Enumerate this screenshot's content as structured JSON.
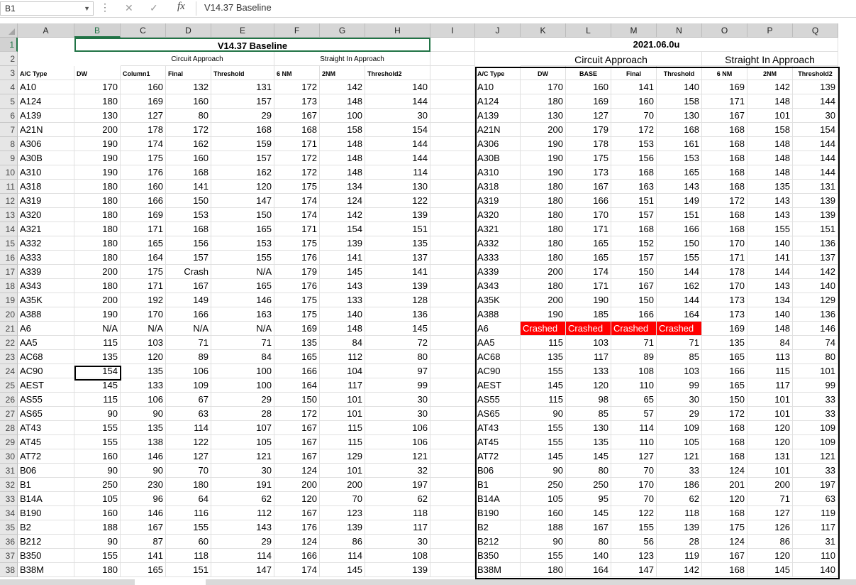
{
  "namebox": "B1",
  "formula_value": "V14.37 Baseline",
  "fx_label": "fx",
  "icons": {
    "cancel": "✕",
    "enter": "✓"
  },
  "column_headers": [
    "A",
    "B",
    "C",
    "D",
    "E",
    "F",
    "G",
    "H",
    "I",
    "J",
    "K",
    "L",
    "M",
    "N",
    "O",
    "P",
    "Q"
  ],
  "row_numbers": [
    "1",
    "2",
    "3",
    "4",
    "5",
    "6",
    "7",
    "8",
    "9",
    "10",
    "11",
    "12",
    "13",
    "14",
    "15",
    "16",
    "17",
    "18",
    "19",
    "20",
    "21",
    "22",
    "23",
    "24",
    "25",
    "26",
    "27",
    "28",
    "29",
    "30",
    "31",
    "32",
    "33",
    "34",
    "35",
    "36",
    "37",
    "38"
  ],
  "left": {
    "title": "V14.37 Baseline",
    "circuit_label": "Circuit Approach",
    "straight_label": "Straight In Approach",
    "headers": [
      "A/C Type",
      "DW",
      "Column1",
      "Final",
      "Threshold",
      "6 NM",
      "2NM",
      "Threshold2"
    ],
    "rows": [
      [
        "A10",
        "170",
        "160",
        "132",
        "131",
        "172",
        "142",
        "140"
      ],
      [
        "A124",
        "180",
        "169",
        "160",
        "157",
        "173",
        "148",
        "144"
      ],
      [
        "A139",
        "130",
        "127",
        "80",
        "29",
        "167",
        "100",
        "30"
      ],
      [
        "A21N",
        "200",
        "178",
        "172",
        "168",
        "168",
        "158",
        "154"
      ],
      [
        "A306",
        "190",
        "174",
        "162",
        "159",
        "171",
        "148",
        "144"
      ],
      [
        "A30B",
        "190",
        "175",
        "160",
        "157",
        "172",
        "148",
        "144"
      ],
      [
        "A310",
        "190",
        "176",
        "168",
        "162",
        "172",
        "148",
        "114"
      ],
      [
        "A318",
        "180",
        "160",
        "141",
        "120",
        "175",
        "134",
        "130"
      ],
      [
        "A319",
        "180",
        "166",
        "150",
        "147",
        "174",
        "124",
        "122"
      ],
      [
        "A320",
        "180",
        "169",
        "153",
        "150",
        "174",
        "142",
        "139"
      ],
      [
        "A321",
        "180",
        "171",
        "168",
        "165",
        "171",
        "154",
        "151"
      ],
      [
        "A332",
        "180",
        "165",
        "156",
        "153",
        "175",
        "139",
        "135"
      ],
      [
        "A333",
        "180",
        "164",
        "157",
        "155",
        "176",
        "141",
        "137"
      ],
      [
        "A339",
        "200",
        "175",
        "Crash",
        "N/A",
        "179",
        "145",
        "141"
      ],
      [
        "A343",
        "180",
        "171",
        "167",
        "165",
        "176",
        "143",
        "139"
      ],
      [
        "A35K",
        "200",
        "192",
        "149",
        "146",
        "175",
        "133",
        "128"
      ],
      [
        "A388",
        "190",
        "170",
        "166",
        "163",
        "175",
        "140",
        "136"
      ],
      [
        "A6",
        "N/A",
        "N/A",
        "N/A",
        "N/A",
        "169",
        "148",
        "145"
      ],
      [
        "AA5",
        "115",
        "103",
        "71",
        "71",
        "135",
        "84",
        "72"
      ],
      [
        "AC68",
        "135",
        "120",
        "89",
        "84",
        "165",
        "112",
        "80"
      ],
      [
        "AC90",
        "154",
        "135",
        "106",
        "100",
        "166",
        "104",
        "97"
      ],
      [
        "AEST",
        "145",
        "133",
        "109",
        "100",
        "164",
        "117",
        "99"
      ],
      [
        "AS55",
        "115",
        "106",
        "67",
        "29",
        "150",
        "101",
        "30"
      ],
      [
        "AS65",
        "90",
        "90",
        "63",
        "28",
        "172",
        "101",
        "30"
      ],
      [
        "AT43",
        "155",
        "135",
        "114",
        "107",
        "167",
        "115",
        "106"
      ],
      [
        "AT45",
        "155",
        "138",
        "122",
        "105",
        "167",
        "115",
        "106"
      ],
      [
        "AT72",
        "160",
        "146",
        "127",
        "121",
        "167",
        "129",
        "121"
      ],
      [
        "B06",
        "90",
        "90",
        "70",
        "30",
        "124",
        "101",
        "32"
      ],
      [
        "B1",
        "250",
        "230",
        "180",
        "191",
        "200",
        "200",
        "197"
      ],
      [
        "B14A",
        "105",
        "96",
        "64",
        "62",
        "120",
        "70",
        "62"
      ],
      [
        "B190",
        "160",
        "146",
        "116",
        "112",
        "167",
        "123",
        "118"
      ],
      [
        "B2",
        "188",
        "167",
        "155",
        "143",
        "176",
        "139",
        "117"
      ],
      [
        "B212",
        "90",
        "87",
        "60",
        "29",
        "124",
        "86",
        "30"
      ],
      [
        "B350",
        "155",
        "141",
        "118",
        "114",
        "166",
        "114",
        "108"
      ],
      [
        "B38M",
        "180",
        "165",
        "151",
        "147",
        "174",
        "145",
        "139"
      ]
    ]
  },
  "right": {
    "title": "2021.06.0u",
    "circuit_label": "Circuit Approach",
    "straight_label": "Straight In Approach",
    "headers": [
      "A/C Type",
      "DW",
      "BASE",
      "Final",
      "Threshold",
      "6 NM",
      "2NM",
      "Threshold2"
    ],
    "crashed_color": "#ff0000",
    "rows": [
      [
        "A10",
        "170",
        "160",
        "141",
        "140",
        "169",
        "142",
        "139"
      ],
      [
        "A124",
        "180",
        "169",
        "160",
        "158",
        "171",
        "148",
        "144"
      ],
      [
        "A139",
        "130",
        "127",
        "70",
        "130",
        "167",
        "101",
        "30"
      ],
      [
        "A21N",
        "200",
        "179",
        "172",
        "168",
        "168",
        "158",
        "154"
      ],
      [
        "A306",
        "190",
        "178",
        "153",
        "161",
        "168",
        "148",
        "144"
      ],
      [
        "A30B",
        "190",
        "175",
        "156",
        "153",
        "168",
        "148",
        "144"
      ],
      [
        "A310",
        "190",
        "173",
        "168",
        "165",
        "168",
        "148",
        "144"
      ],
      [
        "A318",
        "180",
        "167",
        "163",
        "143",
        "168",
        "135",
        "131"
      ],
      [
        "A319",
        "180",
        "166",
        "151",
        "149",
        "172",
        "143",
        "139"
      ],
      [
        "A320",
        "180",
        "170",
        "157",
        "151",
        "168",
        "143",
        "139"
      ],
      [
        "A321",
        "180",
        "171",
        "168",
        "166",
        "168",
        "155",
        "151"
      ],
      [
        "A332",
        "180",
        "165",
        "152",
        "150",
        "170",
        "140",
        "136"
      ],
      [
        "A333",
        "180",
        "165",
        "157",
        "155",
        "171",
        "141",
        "137"
      ],
      [
        "A339",
        "200",
        "174",
        "150",
        "144",
        "178",
        "144",
        "142"
      ],
      [
        "A343",
        "180",
        "171",
        "167",
        "162",
        "170",
        "143",
        "140"
      ],
      [
        "A35K",
        "200",
        "190",
        "150",
        "144",
        "173",
        "134",
        "129"
      ],
      [
        "A388",
        "190",
        "185",
        "166",
        "164",
        "173",
        "140",
        "136"
      ],
      [
        "A6",
        "Crashed",
        "Crashed",
        "Crashed",
        "Crashed",
        "169",
        "148",
        "146"
      ],
      [
        "AA5",
        "115",
        "103",
        "71",
        "71",
        "135",
        "84",
        "74"
      ],
      [
        "AC68",
        "135",
        "117",
        "89",
        "85",
        "165",
        "113",
        "80"
      ],
      [
        "AC90",
        "155",
        "133",
        "108",
        "103",
        "166",
        "115",
        "101"
      ],
      [
        "AEST",
        "145",
        "120",
        "110",
        "99",
        "165",
        "117",
        "99"
      ],
      [
        "AS55",
        "115",
        "98",
        "65",
        "30",
        "150",
        "101",
        "33"
      ],
      [
        "AS65",
        "90",
        "85",
        "57",
        "29",
        "172",
        "101",
        "33"
      ],
      [
        "AT43",
        "155",
        "130",
        "114",
        "109",
        "168",
        "120",
        "109"
      ],
      [
        "AT45",
        "155",
        "135",
        "110",
        "105",
        "168",
        "120",
        "109"
      ],
      [
        "AT72",
        "145",
        "145",
        "127",
        "121",
        "168",
        "131",
        "121"
      ],
      [
        "B06",
        "90",
        "80",
        "70",
        "33",
        "124",
        "101",
        "33"
      ],
      [
        "B1",
        "250",
        "250",
        "170",
        "186",
        "201",
        "200",
        "197"
      ],
      [
        "B14A",
        "105",
        "95",
        "70",
        "62",
        "120",
        "71",
        "63"
      ],
      [
        "B190",
        "160",
        "145",
        "122",
        "118",
        "168",
        "127",
        "119"
      ],
      [
        "B2",
        "188",
        "167",
        "155",
        "139",
        "175",
        "126",
        "117"
      ],
      [
        "B212",
        "90",
        "80",
        "56",
        "28",
        "124",
        "86",
        "31"
      ],
      [
        "B350",
        "155",
        "140",
        "123",
        "119",
        "167",
        "120",
        "110"
      ],
      [
        "B38M",
        "180",
        "164",
        "147",
        "142",
        "168",
        "145",
        "140"
      ]
    ]
  }
}
